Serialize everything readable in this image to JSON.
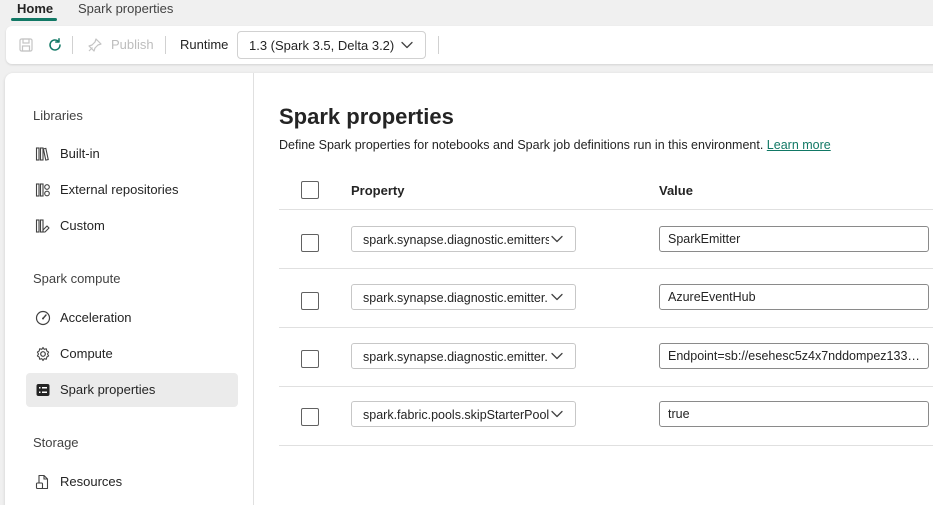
{
  "tabs": [
    {
      "label": "Home",
      "active": true
    },
    {
      "label": "Spark properties",
      "active": false
    }
  ],
  "toolbar": {
    "publish_label": "Publish",
    "runtime_label": "Runtime",
    "runtime_value": "1.3 (Spark 3.5, Delta 3.2)"
  },
  "sidebar": {
    "sections": [
      {
        "title": "Libraries",
        "items": [
          {
            "label": "Built-in",
            "icon": "library-books-icon"
          },
          {
            "label": "External repositories",
            "icon": "library-external-icon"
          },
          {
            "label": "Custom",
            "icon": "library-custom-icon"
          }
        ]
      },
      {
        "title": "Spark compute",
        "items": [
          {
            "label": "Acceleration",
            "icon": "gauge-icon"
          },
          {
            "label": "Compute",
            "icon": "gear-icon"
          },
          {
            "label": "Spark properties",
            "icon": "properties-list-icon",
            "active": true
          }
        ]
      },
      {
        "title": "Storage",
        "items": [
          {
            "label": "Resources",
            "icon": "document-folder-icon"
          }
        ]
      }
    ]
  },
  "content": {
    "title": "Spark properties",
    "description": "Define Spark properties for notebooks and Spark job definitions run in this environment.",
    "learn_more": "Learn more",
    "columns": {
      "property": "Property",
      "value": "Value"
    },
    "rows": [
      {
        "property": "spark.synapse.diagnostic.emitters",
        "value": "SparkEmitter"
      },
      {
        "property": "spark.synapse.diagnostic.emitter.",
        "value": "AzureEventHub"
      },
      {
        "property": "spark.synapse.diagnostic.emitter.",
        "value": "Endpoint=sb://esehesc5z4x7nddompez133...."
      },
      {
        "property": "spark.fabric.pools.skipStarterPools",
        "value": "true"
      }
    ]
  },
  "colors": {
    "accent": "#117865",
    "active_nav_bg": "#ebebeb",
    "page_bg": "#f0f0f0"
  }
}
